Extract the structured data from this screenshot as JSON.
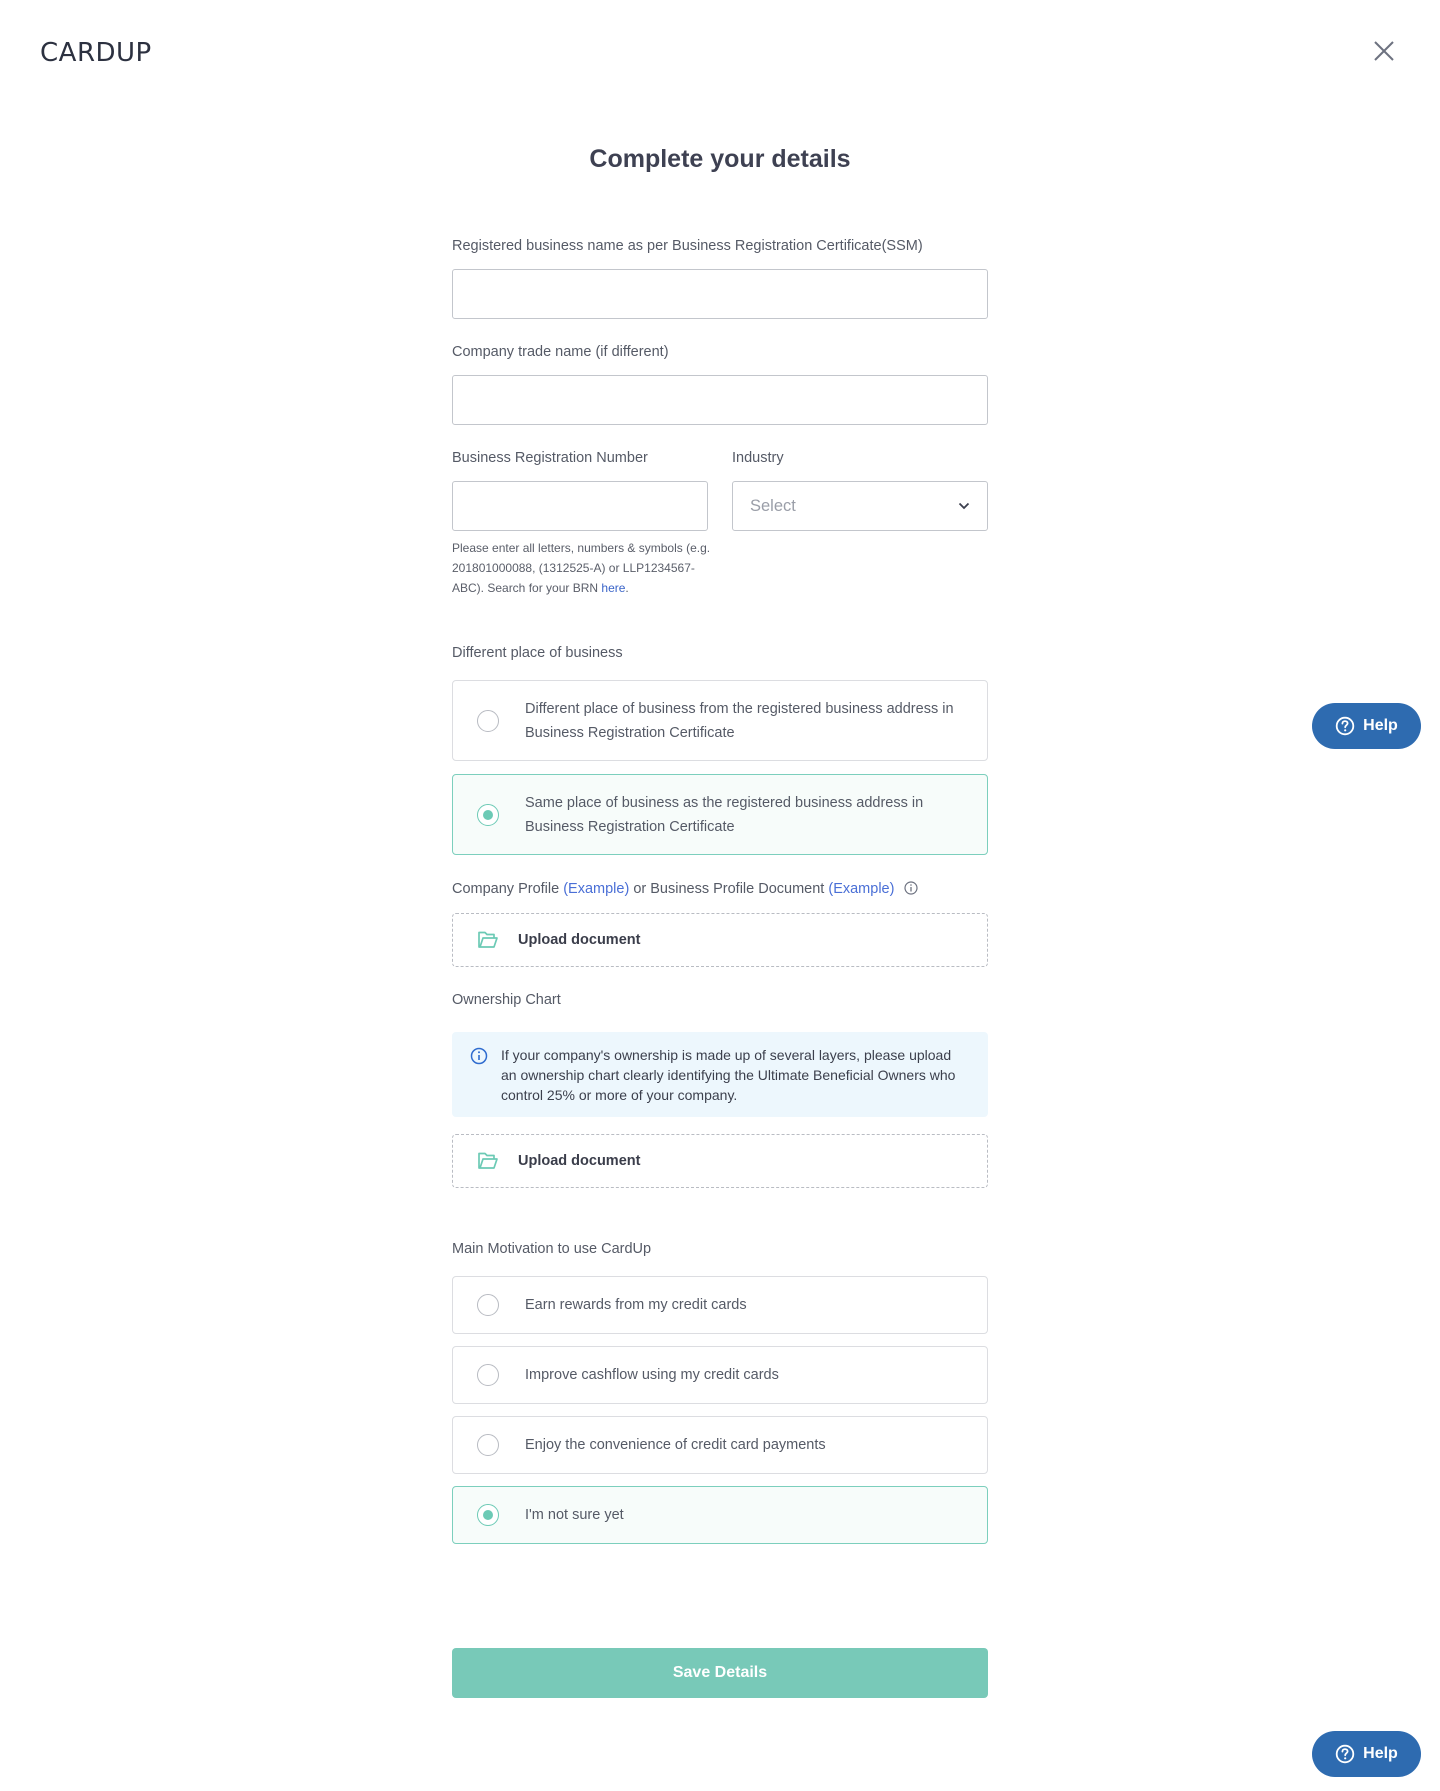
{
  "brand": {
    "logo_text": "CARDUP"
  },
  "page": {
    "title": "Complete your details"
  },
  "fields": {
    "business_name": {
      "label": "Registered business name as per Business Registration Certificate(SSM)",
      "value": "",
      "placeholder": ""
    },
    "trade_name": {
      "label": "Company trade name (if different)",
      "value": "",
      "placeholder": ""
    },
    "brn": {
      "label": "Business Registration Number",
      "value": "",
      "hint": "Please enter all letters, numbers & symbols (e.g. 201801000088, (1312525-A) or LLP1234567-ABC). Search for your BRN",
      "hint_link": "here",
      "hint_end": "."
    },
    "industry": {
      "label": "Industry",
      "placeholder": "Select"
    }
  },
  "place_of_business": {
    "label": "Different place of business",
    "options": [
      {
        "text": "Different place of business from the registered business address in Business Registration Certificate",
        "selected": false
      },
      {
        "text": "Same place of business as the registered business address in Business Registration Certificate",
        "selected": true
      }
    ]
  },
  "company_profile": {
    "label_a": "Company Profile",
    "link_a": "(Example)",
    "label_b": "or Business Profile Document",
    "link_b": "(Example)",
    "upload_label": "Upload document"
  },
  "ownership_chart": {
    "label": "Ownership Chart",
    "info": "If your company's ownership is made up of several layers, please upload an ownership chart clearly identifying the Ultimate Beneficial Owners who control 25% or more of your company.",
    "upload_label": "Upload document"
  },
  "motivation": {
    "label": "Main Motivation to use CardUp",
    "options": [
      {
        "text": "Earn rewards from my credit cards",
        "selected": false
      },
      {
        "text": "Improve cashflow using my credit cards",
        "selected": false
      },
      {
        "text": "Enjoy the convenience of credit card payments",
        "selected": false
      },
      {
        "text": "I'm not sure yet",
        "selected": true
      }
    ]
  },
  "actions": {
    "save_label": "Save Details"
  },
  "help": {
    "label": "Help"
  },
  "colors": {
    "accent": "#6ccab5",
    "help_button": "#2e6bb0",
    "save_button": "#78c9b8",
    "link": "#4a6fd6",
    "info_bg": "#edf7fd"
  }
}
